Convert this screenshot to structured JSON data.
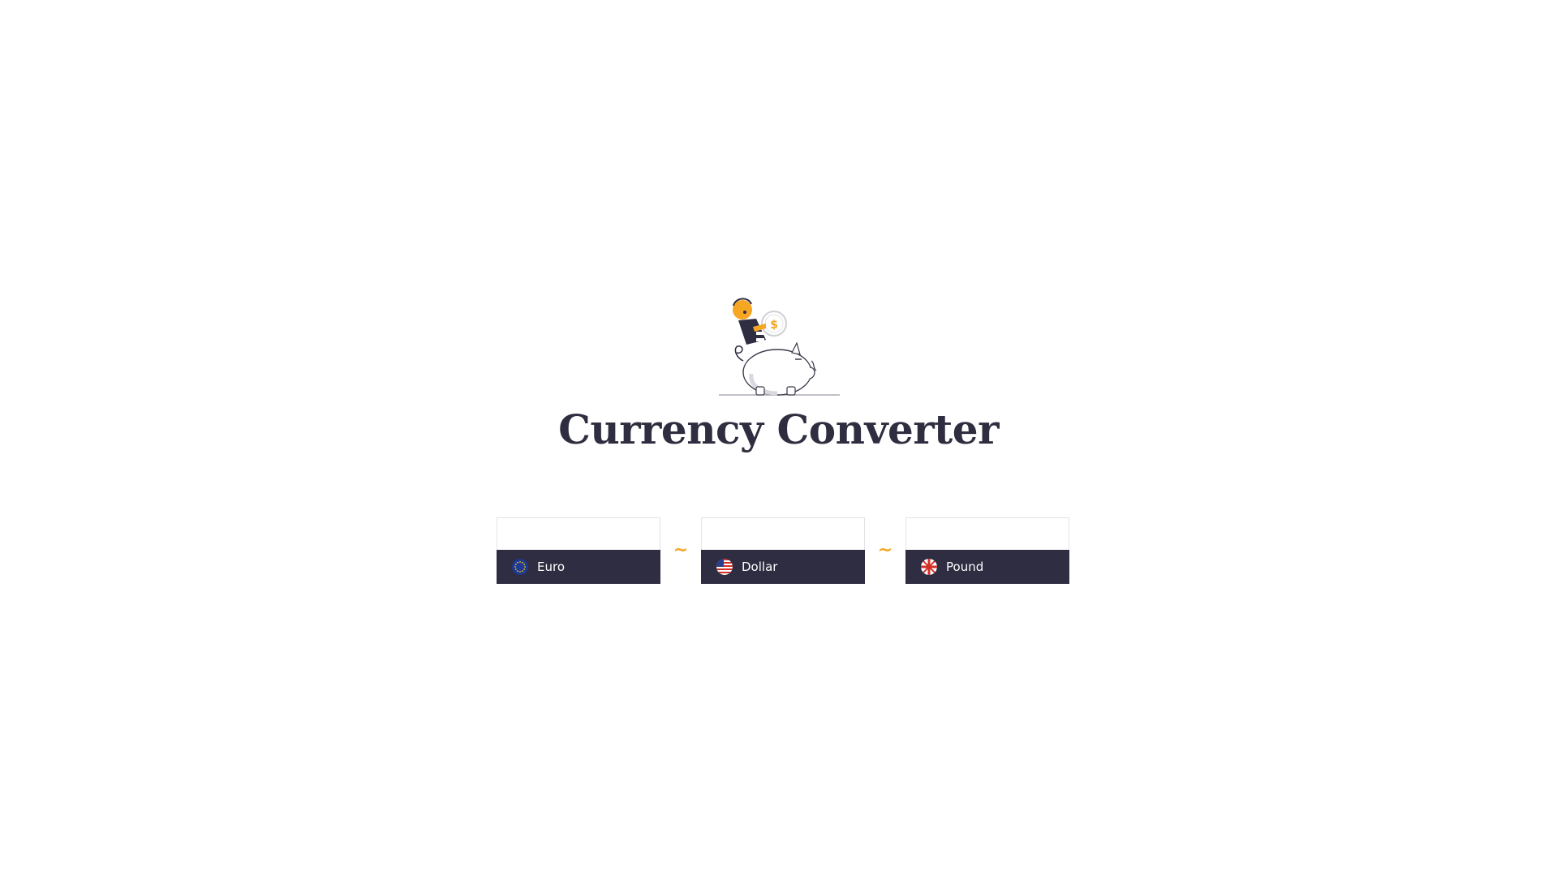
{
  "page": {
    "title": "Currency Converter",
    "illustration_icon": "piggy-bank-icon"
  },
  "separator": "~",
  "currencies": [
    {
      "name": "Euro",
      "amount": "",
      "flag_icon": "eu-flag-icon"
    },
    {
      "name": "Dollar",
      "amount": "",
      "flag_icon": "us-flag-icon"
    },
    {
      "name": "Pound",
      "amount": "",
      "flag_icon": "uk-flag-icon"
    }
  ],
  "colors": {
    "accent": "#f5a623",
    "dark": "#2e2d42",
    "title": "#2e2e40",
    "background": "#ffffff"
  }
}
